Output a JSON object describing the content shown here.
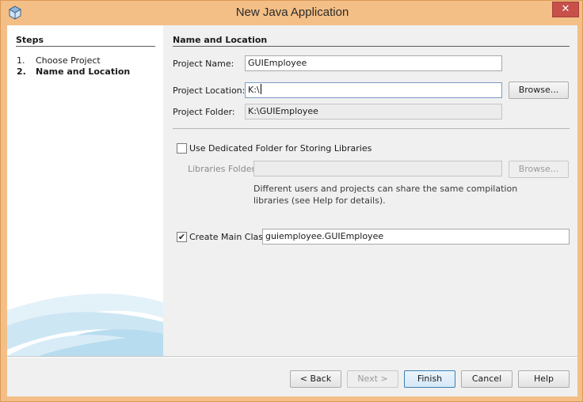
{
  "window": {
    "title": "New Java Application",
    "close_glyph": "✕",
    "app_icon": "java-cup-cube-icon"
  },
  "steps": {
    "heading": "Steps",
    "items": [
      {
        "number": "1.",
        "label": "Choose Project",
        "current": false
      },
      {
        "number": "2.",
        "label": "Name and Location",
        "current": true
      }
    ]
  },
  "content": {
    "heading": "Name and Location",
    "project_name_label": "Project Name:",
    "project_name_value": "GUIEmployee",
    "project_location_label": "Project Location:",
    "project_location_value": "K:\\",
    "project_location_browse": "Browse...",
    "project_folder_label": "Project Folder:",
    "project_folder_value": "K:\\GUIEmployee",
    "dedicated_folder_label": "Use Dedicated Folder for Storing Libraries",
    "dedicated_folder_checked": false,
    "libraries_folder_label": "Libraries Folder:",
    "libraries_folder_value": "",
    "libraries_browse": "Browse...",
    "hint_line1": "Different users and projects can share the same compilation",
    "hint_line2": "libraries (see Help for details).",
    "create_main_class_label": "Create Main Class",
    "create_main_class_checked": true,
    "check_glyph": "✔",
    "main_class_value": "guiemployee.GUIEmployee"
  },
  "buttons": {
    "back": "< Back",
    "next": "Next >",
    "finish": "Finish",
    "cancel": "Cancel",
    "help": "Help"
  },
  "colors": {
    "title_bar": "#f3bf86",
    "close_button": "#c7504a",
    "dialog_background": "#f0f0f0",
    "steps_background": "#ffffff",
    "swoosh_accent": "#b7dcef"
  }
}
